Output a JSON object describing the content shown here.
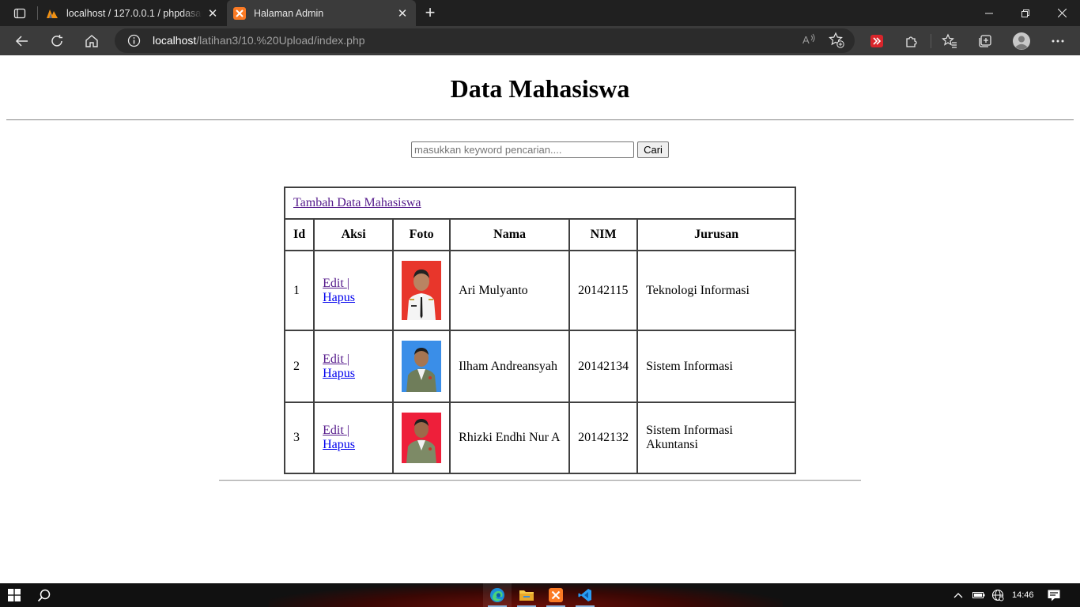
{
  "browser": {
    "tabs": [
      {
        "title": "localhost / 127.0.0.1 / phpdasar / m",
        "active": false
      },
      {
        "title": "Halaman Admin",
        "active": true
      }
    ],
    "address": {
      "host": "localhost",
      "path": "/latihan3/10.%20Upload/index.php"
    }
  },
  "page": {
    "title": "Data Mahasiswa",
    "search": {
      "placeholder": "masukkan keyword pencarian....",
      "value": "",
      "button": "Cari"
    },
    "add_link": "Tambah Data Mahasiswa",
    "table": {
      "headers": [
        "Id",
        "Aksi",
        "Foto",
        "Nama",
        "NIM",
        "Jurusan"
      ],
      "edit_label": "Edit ",
      "separator": "|",
      "delete_label": "Hapus",
      "rows": [
        {
          "id": "1",
          "nama": "Ari Mulyanto",
          "nim": "20142115",
          "jurusan": "Teknologi Informasi",
          "photo_bg": "#e8362b"
        },
        {
          "id": "2",
          "nama": "Ilham Andreansyah",
          "nim": "20142134",
          "jurusan": "Sistem Informasi",
          "photo_bg": "#3a8ee8"
        },
        {
          "id": "3",
          "nama": "Rhizki Endhi Nur A",
          "nim": "20142132",
          "jurusan": "Sistem Informasi Akuntansi",
          "photo_bg": "#ee1f3a"
        }
      ]
    }
  },
  "taskbar": {
    "time": "14:46"
  }
}
